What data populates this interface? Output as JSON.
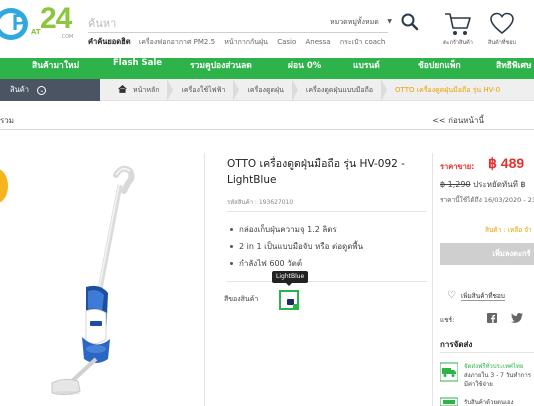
{
  "header": {
    "logo": {
      "text_p": "P",
      "text_at": "AT",
      "text_24": "24",
      "text_com": ".COM"
    },
    "search": {
      "placeholder": "ค้นหา",
      "category_label": "หมวดหมู่ทั้งหมด"
    },
    "popular": {
      "label": "คำค้นยอดฮิต",
      "tags": [
        "เครื่องฟอกอากาศ PM2.5",
        "หน้ากากกันฝุ่น",
        "Casio",
        "Anessa",
        "กระเป๋า coach"
      ]
    },
    "cart_label": "ตะกร้าสินค้า",
    "wishlist_label": "สินค้าที่ชอบ",
    "icons": {
      "search": "search-icon",
      "cart": "cart-icon",
      "wishlist": "heart-icon"
    }
  },
  "nav": {
    "items": [
      "สินค้ามาใหม่",
      "Flash Sale",
      "รวมคูปองส่วนลด",
      "ผ่อน 0%",
      "แบรนด์",
      "ช้อปยกแพ็ก",
      "สิทธิพิเศษ"
    ]
  },
  "breadcrumb": {
    "menu_label": "สินค้า",
    "items": [
      "หน้าหลัก",
      "เครื่องใช้ไฟฟ้า",
      "เครื่องดูดฝุ่น",
      "เครื่องดูดฝุ่นแบบมือถือ",
      "OTTO เครื่องดูดฝุ่นมือถือ รุ่น HV-0"
    ]
  },
  "backrow": {
    "all": "รวม",
    "back": "<< ก่อนหน้านี้"
  },
  "product": {
    "title": "OTTO เครื่องดูดฝุ่นมือถือ รุ่น HV-092 - LightBlue",
    "sku": "รหัสสินค้า : 193627010",
    "features": [
      "กล่องเก็บฝุ่นความจุ 1.2 ลิตร",
      "2 in 1 เป็นแบบมือจับ หรือ ต่อดูดพื้น",
      "กำลังไฟ 600 วัตต์"
    ],
    "color_label": "สีของสินค้า",
    "color_tooltip": "LightBlue"
  },
  "pricing": {
    "price_label": "ราคาขาย:",
    "price": "฿ 489",
    "old_price": "฿ 1,290",
    "saving_label": "ประหยัดทันที",
    "saving_value": "฿",
    "promo_note": "ราคานี้ใช้ได้ถึง 16/03/2020 - 23:",
    "stock_note": "สินค้า : เหลือ จำ",
    "add_button": "เพิ่มลงตะกร้",
    "wishlist": "เพิ่มสินค้าที่ชอบ",
    "share_label": "แชร์:",
    "shipping_title": "การจัดส่ง",
    "shipping_text_1": "จัดส่งฟรีทั่วประเทศไทย",
    "shipping_text_2": "ส่งภายใน 3 - 7 วันทำการ",
    "shipping_text_3": "มีค่าใช้จ่าย",
    "shipping_text_4": "รับสินค้าด้วยตนเอง"
  },
  "colors": {
    "green": "#2db34a",
    "red": "#e5322d",
    "orange": "#e8a100",
    "blue": "#2fa8e0",
    "dark_nav": "#4a5463"
  }
}
